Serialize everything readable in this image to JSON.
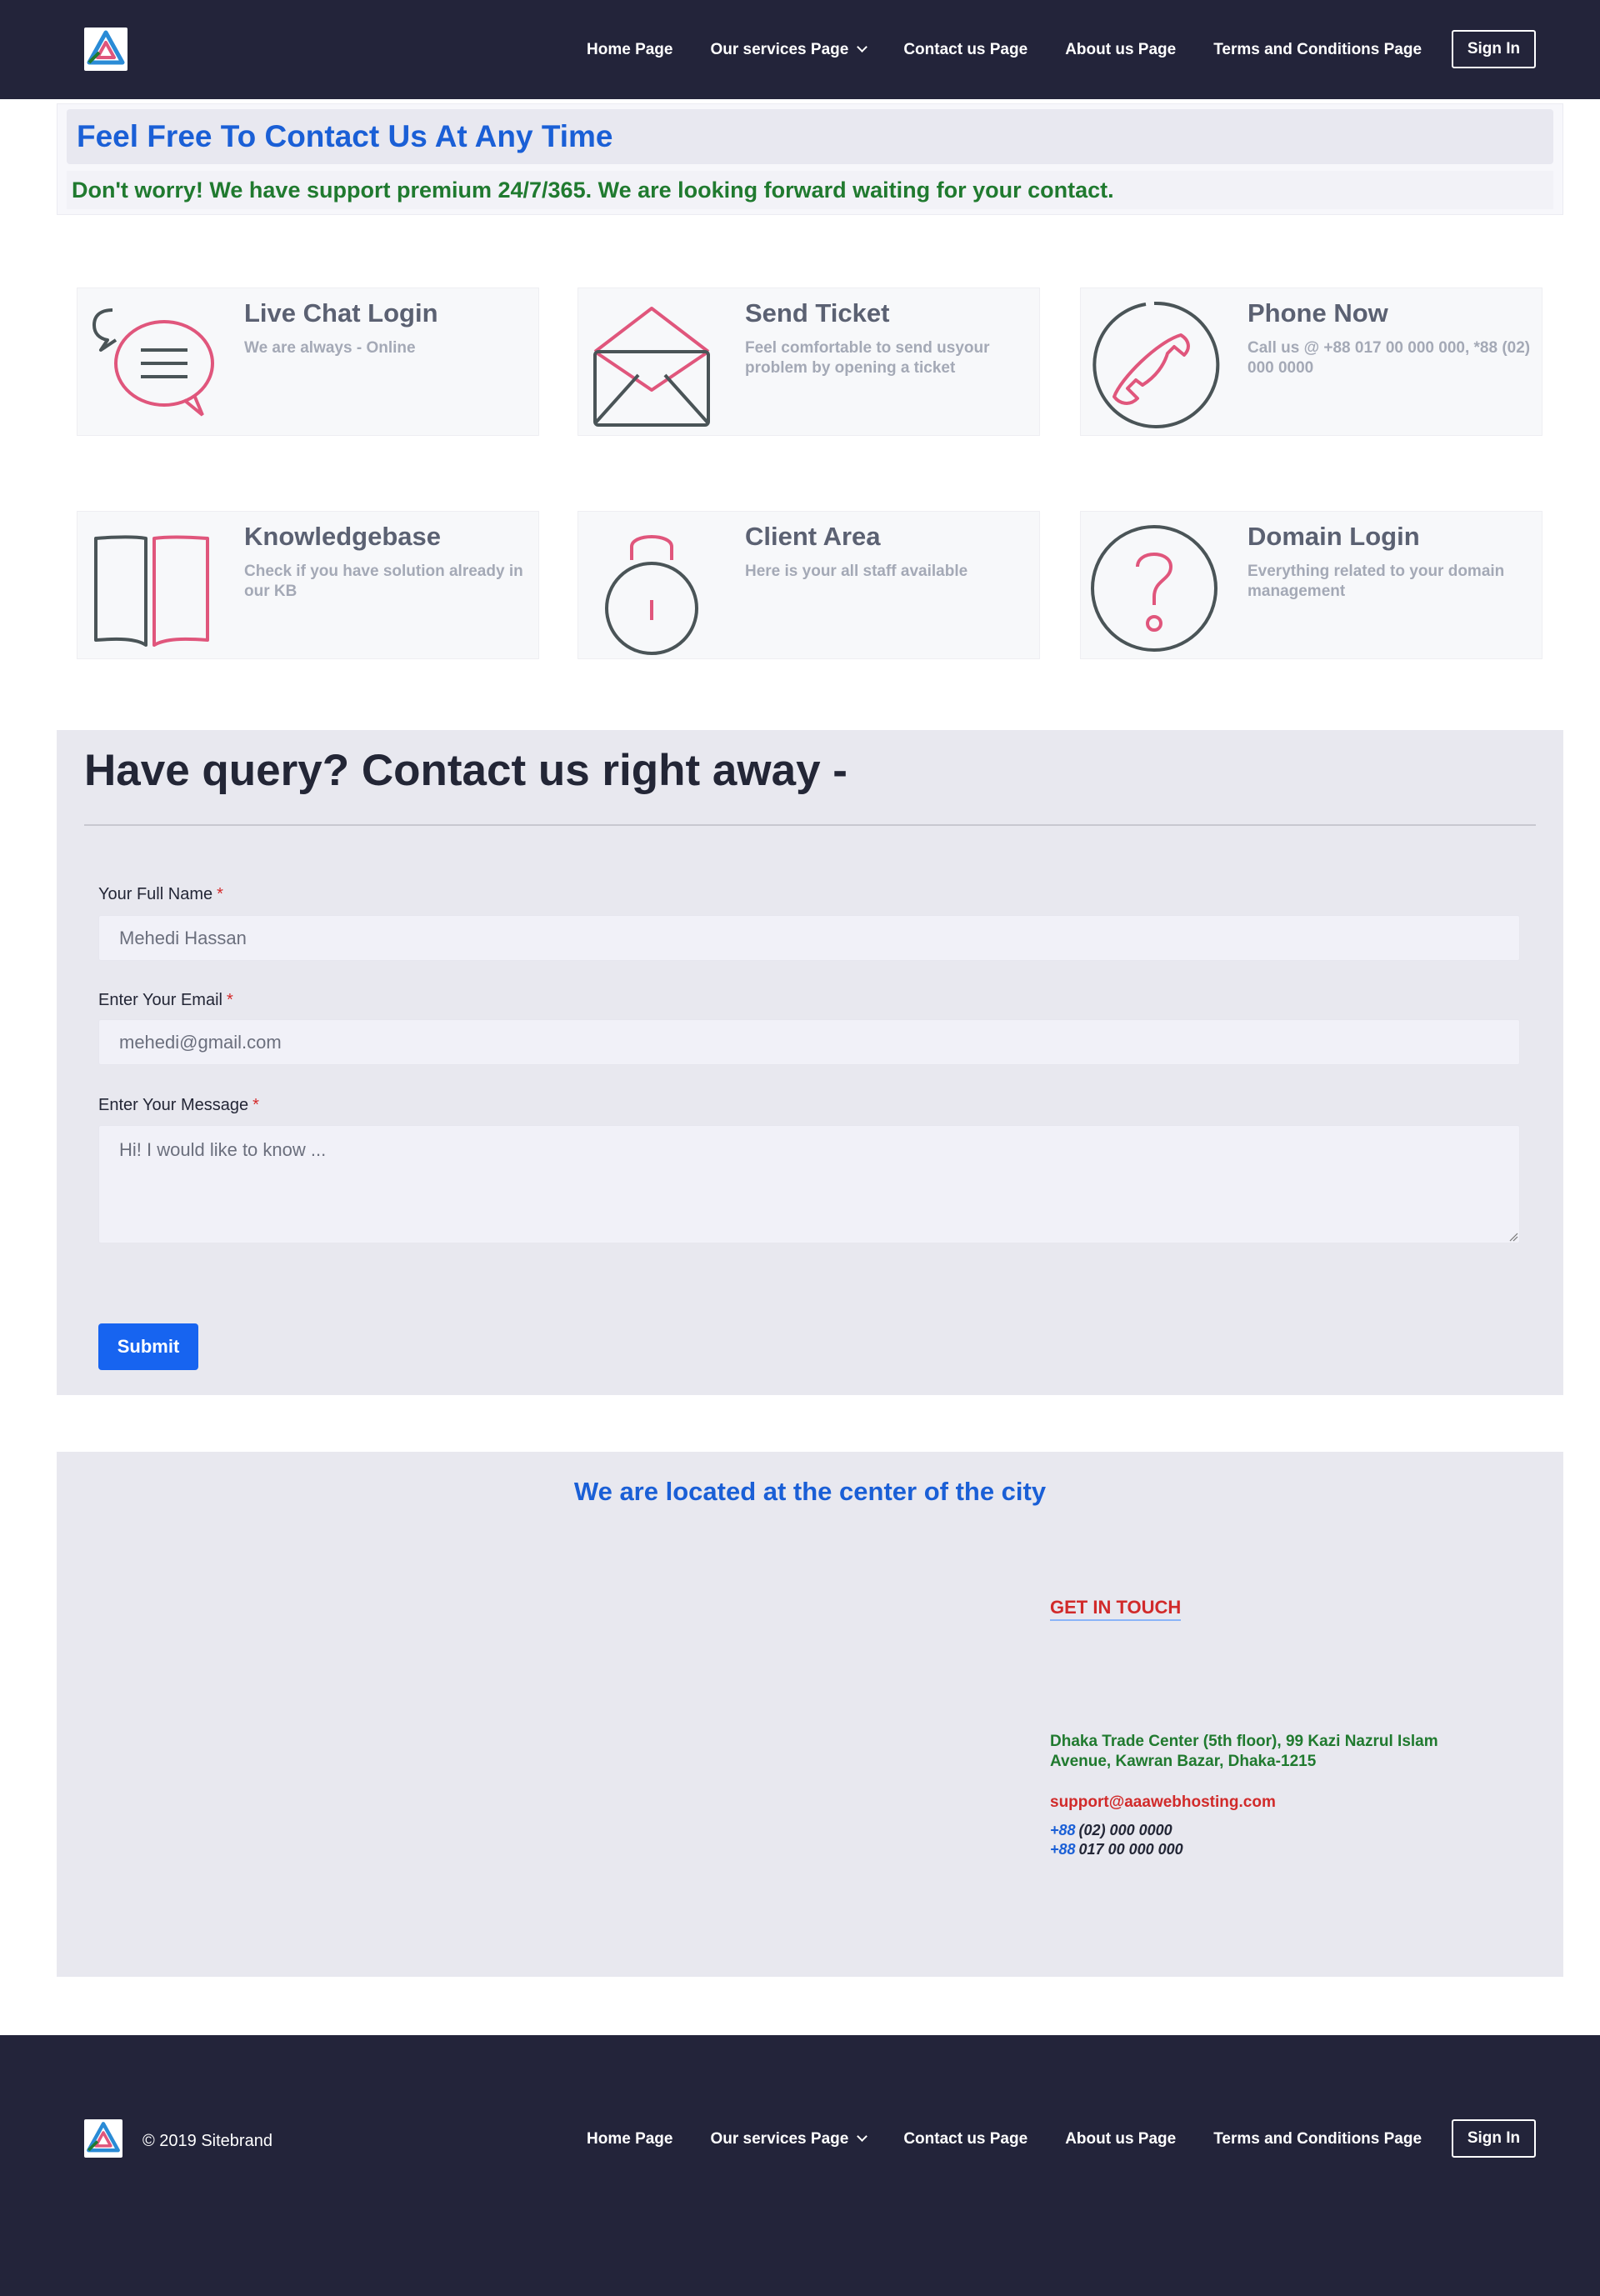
{
  "header": {
    "logo": "sitebrand-logo-icon",
    "nav": [
      {
        "label": "Home Page"
      },
      {
        "label": "Our services Page",
        "dropdown": true
      },
      {
        "label": "Contact us Page"
      },
      {
        "label": "About us Page"
      },
      {
        "label": "Terms and Conditions Page"
      }
    ],
    "signin_label": "Sign In"
  },
  "hero": {
    "title": "Feel Free To Contact Us At Any Time",
    "subtitle": "Don't worry! We have support premium 24/7/365. We are looking forward waiting for your contact."
  },
  "cards": [
    {
      "title": "Live Chat Login",
      "desc": "We are always - Online",
      "icon": "chat-bubbles-icon"
    },
    {
      "title": "Send Ticket",
      "desc": "Feel comfortable to send usyour problem by opening a ticket",
      "icon": "envelope-icon"
    },
    {
      "title": "Phone Now",
      "desc": "Call us @ +88 017 00 000 000, *88 (02) 000 0000",
      "icon": "phone-icon"
    },
    {
      "title": "Knowledgebase",
      "desc": "Check if you have solution already in our KB",
      "icon": "book-icon"
    },
    {
      "title": "Client Area",
      "desc": "Here is your all staff available",
      "icon": "padlock-icon"
    },
    {
      "title": "Domain Login",
      "desc": "Everything related to your domain management",
      "icon": "question-circle-icon"
    }
  ],
  "form": {
    "heading": "Have query? Contact us right away -",
    "name_label": "Your Full Name",
    "name_placeholder": "Mehedi Hassan",
    "email_label": "Enter Your Email",
    "email_placeholder": "mehedi@gmail.com",
    "message_label": "Enter Your Message",
    "message_placeholder": "Hi! I would like to know ...",
    "required_mark": "*",
    "submit_label": "Submit"
  },
  "location": {
    "title": "We are located at the center of the city",
    "get_in_touch": "GET IN TOUCH",
    "address": "Dhaka Trade Center (5th floor), 99 Kazi Nazrul Islam Avenue, Kawran Bazar, Dhaka-1215",
    "email": "support@aaawebhosting.com",
    "phones": [
      {
        "code": "+88",
        "number": "(02) 000 0000"
      },
      {
        "code": "+88",
        "number": "017 00 000 000"
      }
    ]
  },
  "footer": {
    "copyright": "© 2019 Sitebrand"
  },
  "colors": {
    "navbar_bg": "#23243a",
    "accent_blue": "#1a5fd6",
    "accent_green": "#207a2f",
    "accent_red": "#d12a2a",
    "icon_pink": "#e0567c",
    "icon_gray": "#4a5457"
  }
}
